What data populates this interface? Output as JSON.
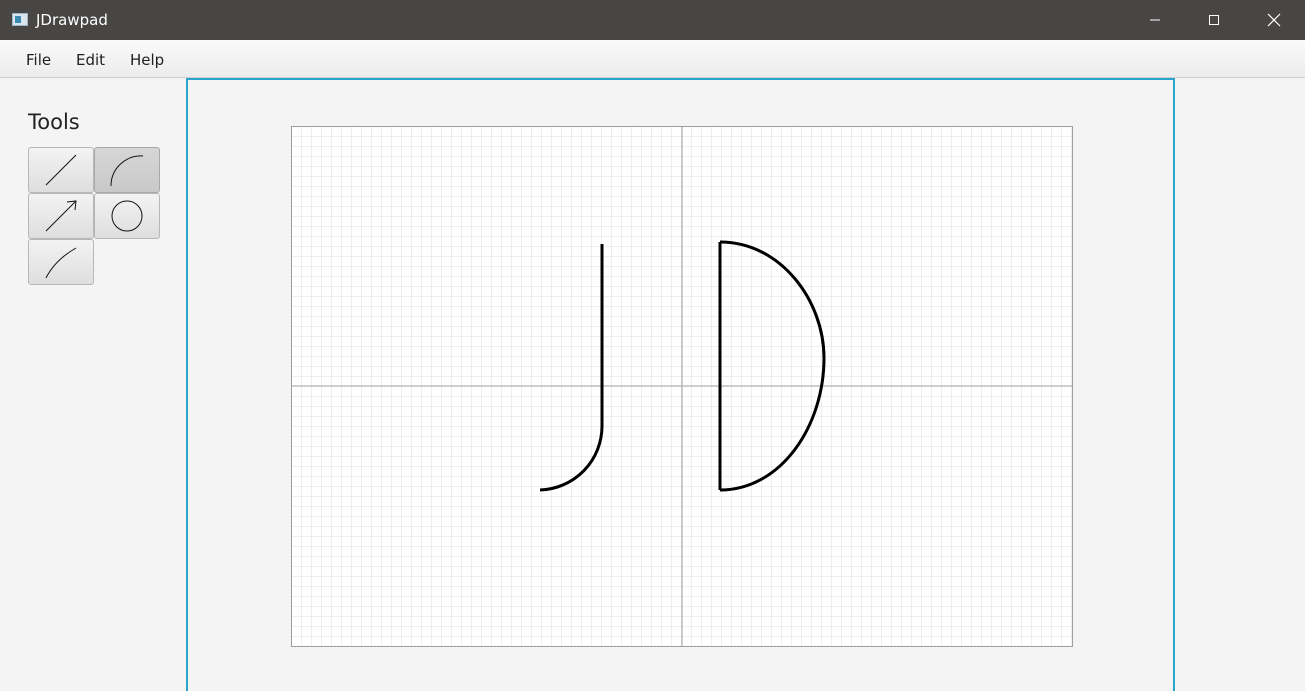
{
  "window": {
    "title": "JDrawpad",
    "app_icon": "app-window-icon",
    "controls": [
      "minimize-icon",
      "maximize-icon",
      "close-icon"
    ]
  },
  "menu": {
    "file_label": "File",
    "edit_label": "Edit",
    "help_label": "Help"
  },
  "tools": {
    "heading": "Tools",
    "buttons": [
      {
        "name": "line-tool",
        "icon": "line-icon",
        "selected": false
      },
      {
        "name": "arc-tool",
        "icon": "arc-icon",
        "selected": true
      },
      {
        "name": "arrow-tool",
        "icon": "arrow-icon",
        "selected": false
      },
      {
        "name": "ellipse-tool",
        "icon": "ellipse-icon",
        "selected": false
      },
      {
        "name": "curve-tool",
        "icon": "curve-icon",
        "selected": false
      }
    ]
  },
  "canvas": {
    "grid": true,
    "axes": true,
    "accent_color": "#2aa3cf",
    "drawn_shapes": [
      "letter-j-stroke",
      "letter-d-stroke"
    ]
  }
}
